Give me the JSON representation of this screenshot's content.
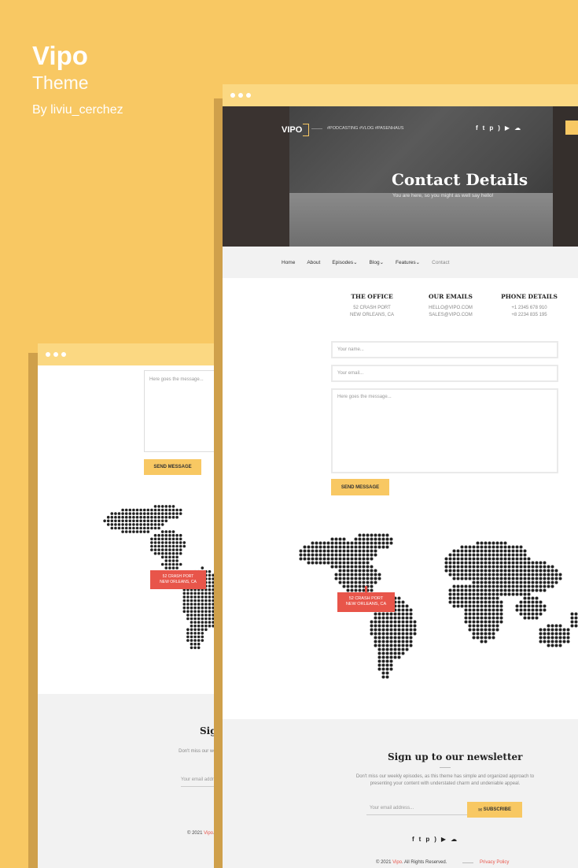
{
  "brand": {
    "name": "Vipo",
    "theme": "Theme",
    "byline": "By liviu_cerchez"
  },
  "front": {
    "logo": "VIPO",
    "tagline": "#PODCASTING #VLOG #PASENHAUS",
    "social_icons": [
      "facebook-icon",
      "twitter-icon",
      "pinterest-icon",
      "rss-icon",
      "youtube-icon",
      "soundcloud-icon"
    ],
    "hero_title": "Contact Details",
    "hero_subtitle": "You are here, so you might as well say hello!",
    "nav": [
      "Home",
      "About",
      "Episodes",
      "Blog",
      "Features",
      "Contact"
    ],
    "columns": [
      {
        "title": "THE OFFICE",
        "lines": [
          "52 CRASH PORT",
          "NEW ORLEANS, CA"
        ]
      },
      {
        "title": "OUR EMAILS",
        "lines": [
          "HELLO@VIPO.COM",
          "SALES@VIPO.COM"
        ]
      },
      {
        "title": "PHONE DETAILS",
        "lines": [
          "+1 2345 678 910",
          "+8 2234 835 195"
        ]
      }
    ],
    "name_placeholder": "Your name...",
    "email_placeholder": "Your email...",
    "message_placeholder": "Here goes the message...",
    "send_label": "SEND MESSAGE",
    "map_pin": [
      "52 CRASH PORT",
      "NEW ORLEANS, CA"
    ],
    "newsletter_title": "Sign up to our newsletter",
    "newsletter_desc": "Don't miss our weekly episodes, as this theme has simple and organized approach to presenting your content with understated charm and undeniable appeal.",
    "newsletter_placeholder": "Your email address...",
    "subscribe_label": "SUBSCRIBE",
    "copyright_pre": "© 2021",
    "copyright_brand": "Vipo",
    "copyright_post": ". All Rights Reserved.",
    "privacy": "Privacy Policy"
  },
  "back": {
    "message_placeholder": "Here goes the message...",
    "send_label": "SEND MESSAGE",
    "map_pin": [
      "52 CRASH PORT",
      "NEW ORLEANS, CA"
    ],
    "newsletter_title": "Sign",
    "newsletter_desc": "Don't miss our weekly episodes, approach to presenting y",
    "newsletter_placeholder": "Your email addre",
    "copyright_pre": "© 2021",
    "copyright_brand": "Vipo",
    "copyright_post": ". A"
  },
  "colors": {
    "accent": "#f8c863",
    "pin": "#e8554a"
  }
}
